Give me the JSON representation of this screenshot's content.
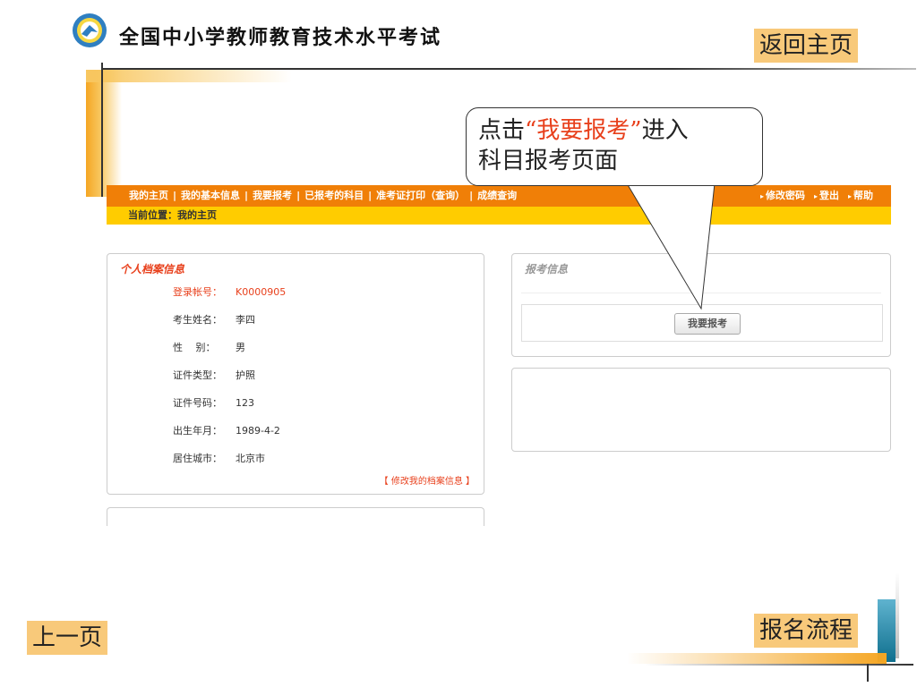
{
  "header": {
    "title": "全国中小学教师教育技术水平考试"
  },
  "slide_nav": {
    "home": "返回主页",
    "prev": "上一页",
    "flow": "报名流程"
  },
  "callout": {
    "prefix": "点击",
    "highlight": "“我要报考”",
    "suffix": "进入",
    "line2": "科目报考页面"
  },
  "site": {
    "nav": {
      "items": [
        "我的主页",
        "我的基本信息",
        "我要报考",
        "已报考的科目",
        "准考证打印（查询）",
        "成绩查询"
      ],
      "right": [
        "修改密码",
        "登出",
        "帮助"
      ]
    },
    "breadcrumb": "当前位置：我的主页",
    "profile": {
      "title": "个人档案信息",
      "fields": [
        {
          "label": "登录帐号：",
          "value": "K0000905"
        },
        {
          "label": "考生姓名：",
          "value": "李四"
        },
        {
          "label": "性　 别：",
          "value": "男"
        },
        {
          "label": "证件类型：",
          "value": "护照"
        },
        {
          "label": "证件号码：",
          "value": "123"
        },
        {
          "label": "出生年月：",
          "value": "1989-4-2"
        },
        {
          "label": "居住城市：",
          "value": "北京市"
        }
      ],
      "edit_link": "【 修改我的档案信息 】"
    },
    "exam": {
      "title": "报考信息",
      "enroll_button": "我要报考"
    }
  },
  "colors": {
    "nav": "#f07f07",
    "breadcrumb": "#ffcc00",
    "highlight": "#e8401c",
    "slide_button": "#f8c97a"
  },
  "icons": {
    "logo": "exam-emblem-icon"
  }
}
